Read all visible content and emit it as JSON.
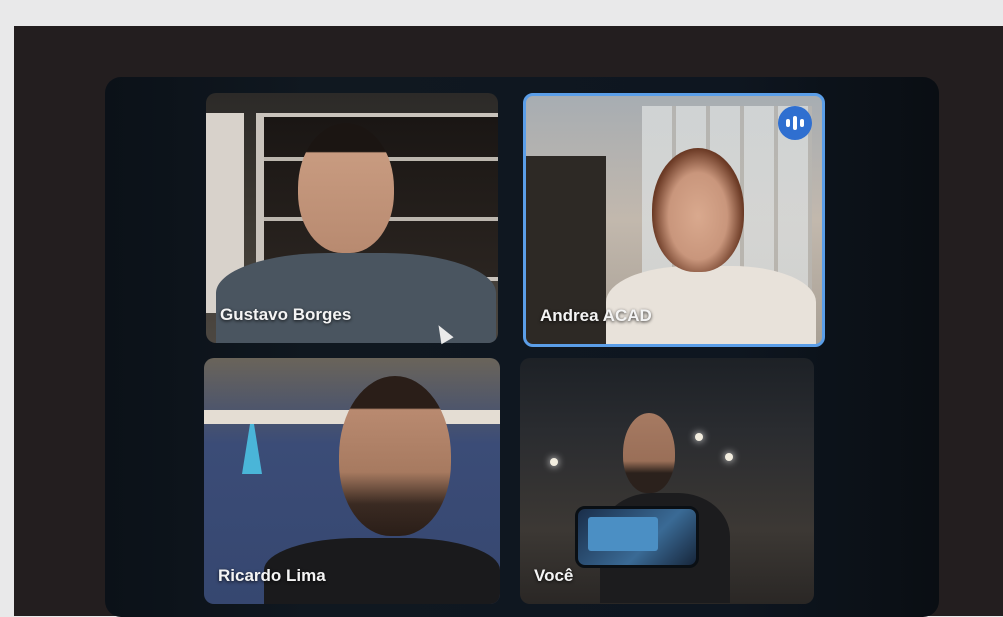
{
  "meeting": {
    "participants": [
      {
        "name": "Gustavo Borges",
        "speaking": false
      },
      {
        "name": "Andrea ACAD",
        "speaking": true
      },
      {
        "name": "Ricardo Lima",
        "speaking": false
      },
      {
        "name": "Você",
        "speaking": false
      }
    ],
    "active_speaker_icon": "audio-wave-icon",
    "colors": {
      "active_border": "#5b9ee8",
      "speaker_badge": "#2f6fd0",
      "frame_background": "#231e1f",
      "screen_background": "#0e1620"
    }
  }
}
